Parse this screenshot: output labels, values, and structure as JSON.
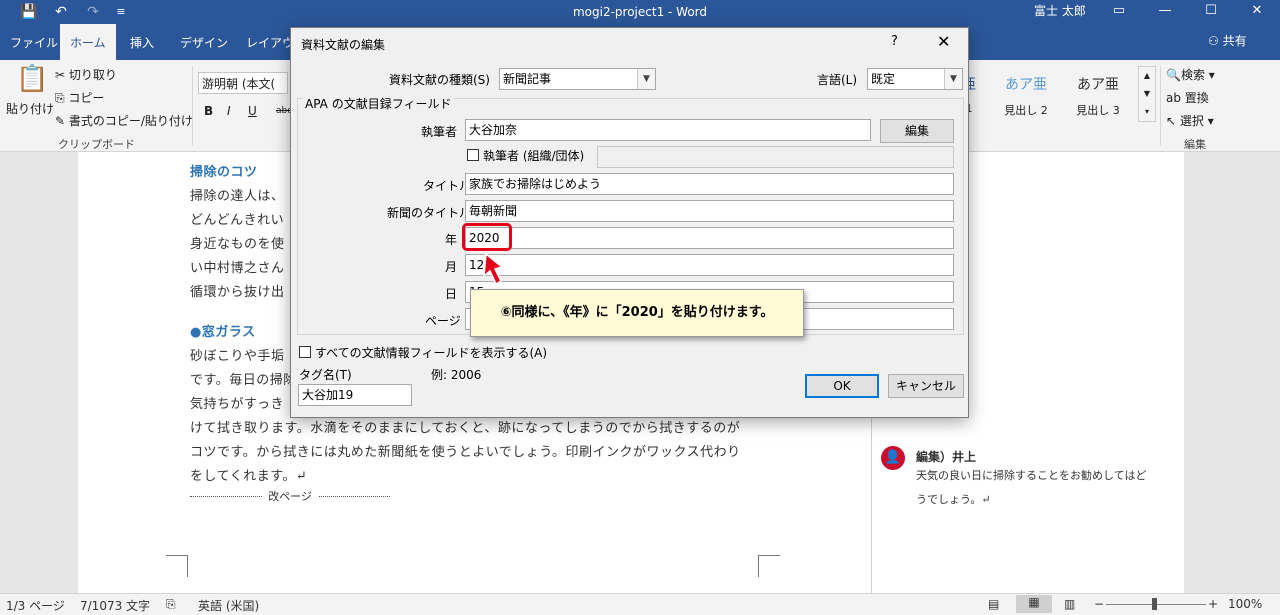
{
  "titlebar": {
    "title": "mogi2-project1  -  Word",
    "user": "富士 太郎",
    "qa_save": "💾",
    "qa_undo": "↶",
    "qa_redo": "↷",
    "qa_more": "≡"
  },
  "tabs": {
    "file": "ファイル",
    "home": "ホーム",
    "insert": "挿入",
    "design": "デザイン",
    "layout": "レイアウト",
    "share": "共有"
  },
  "ribbon": {
    "paste": "貼り付け",
    "cut": "切り取り",
    "copy": "コピー",
    "format_painter": "書式のコピー/貼り付け",
    "clipboard_label": "クリップボード",
    "font_name": "游明朝 (本文(",
    "bold": "B",
    "italic": "I",
    "underline": "U",
    "strike": "abc",
    "style1_preview": "あア亜",
    "style1_label": "見出し 2",
    "style2_preview": "あア亜",
    "style2_label": "見出し 3",
    "style0_preview": "亜",
    "style0_label": "1",
    "find": "検索",
    "replace": "置換",
    "select": "選択",
    "edit_label": "編集"
  },
  "document": {
    "heading1": "掃除のコツ",
    "lines1": [
      "掃除の達人は、",
      "どんどんきれい",
      "身近なものを使",
      "い中村博之さん",
      "循環から抜け出"
    ],
    "heading2": "●窓ガラス",
    "lines2": [
      "砂ぼこりや手垢",
      "です。毎日の掃除",
      "気持ちがすっき"
    ],
    "line_full1": "けて拭き取ります。水滴をそのままにしておくと、跡になってしまうのでから拭きするのが",
    "line_full2": "コツです。から拭きには丸めた新聞紙を使うとよいでしょう。印刷インクがワックス代わり",
    "line_full3": "をしてくれます。↵",
    "page_break": "改ページ"
  },
  "comment": {
    "avatar": "👤",
    "author": "編集）井上",
    "line1": "天気の良い日に掃除することをお勧めしてはど",
    "line2": "うでしょう。↵"
  },
  "dialog": {
    "title": "資料文献の編集",
    "help": "?",
    "close": "✕",
    "source_type_label": "資料文献の種類(S)",
    "source_type_value": "新聞記事",
    "language_label": "言語(L)",
    "language_value": "既定",
    "group_label": "APA の文献目録フィールド",
    "author_label": "執筆者",
    "author_value": "大谷加奈",
    "edit_button": "編集",
    "corp_author_label": "執筆者 (組織/団体)",
    "title_label": "タイトル",
    "title_value": "家族でお掃除はじめよう",
    "newspaper_label": "新聞のタイトル",
    "newspaper_value": "毎朝新聞",
    "year_label": "年",
    "year_value": "2020",
    "month_label": "月",
    "month_value": "12",
    "day_label": "日",
    "day_value": "15",
    "page_label": "ページ",
    "page_value": "",
    "show_all_label": "すべての文献情報フィールドを表示する(A)",
    "tag_label": "タグ名(T)",
    "tag_value": "大谷加19",
    "example": "例: 2006",
    "ok": "OK",
    "cancel": "キャンセル"
  },
  "callout": {
    "text": "⑥同様に、《年》に「2020」を貼り付けます。"
  },
  "statusbar": {
    "page": "1/3 ページ",
    "words": "7/1073 文字",
    "language": "英語 (米国)",
    "zoom": "100%",
    "zoom_minus": "−",
    "zoom_plus": "+"
  },
  "colors": {
    "accent": "#2b579a",
    "highlight_red": "#e3001b",
    "callout_bg": "#fffbd6",
    "heading_blue": "#2e74b5"
  }
}
